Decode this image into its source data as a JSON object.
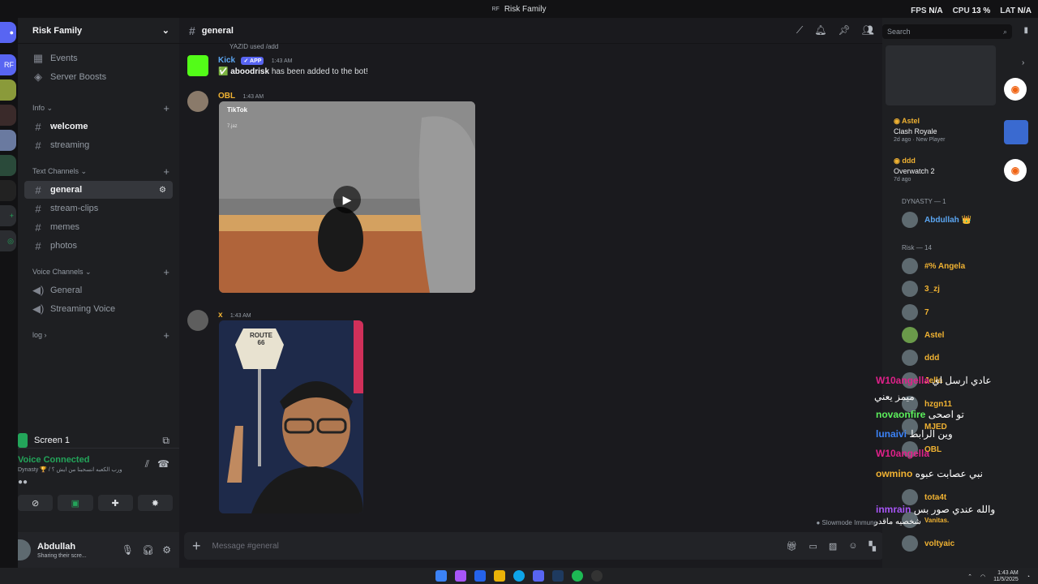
{
  "window": {
    "title": "Risk Family",
    "title_icon": "RF"
  },
  "hud": {
    "fps_label": "FPS",
    "fps_value": "N/A",
    "cpu_label": "CPU",
    "cpu_value": "13 %",
    "lat_label": "LAT",
    "lat_value": "N/A"
  },
  "server": {
    "name": "Risk Family",
    "rail_badge": "RF",
    "top_items": [
      {
        "label": "Events",
        "icon": "calendar-icon"
      },
      {
        "label": "Server Boosts",
        "icon": "boost-icon"
      }
    ],
    "categories": {
      "info": "Info",
      "text": "Text Channels",
      "voice": "Voice Channels",
      "log": "log"
    },
    "info_channels": [
      "welcome",
      "streaming"
    ],
    "text_channels": [
      "general",
      "stream-clips",
      "memes",
      "photos"
    ],
    "voice_channels": [
      "General",
      "Streaming Voice"
    ]
  },
  "screen_share": {
    "label": "Screen 1"
  },
  "voice_status": {
    "title": "Voice Connected",
    "subtitle": "Dynasty 🏆 / ورب الكعبه انسحبنا من ايش ؟"
  },
  "user": {
    "name": "Abdullah",
    "status": "Sharing their scre..."
  },
  "chat": {
    "channel": "general",
    "reply_preview": "YAZID used /add",
    "messages": [
      {
        "author": "Kick",
        "badge": "APP",
        "time": "1:43 AM",
        "mention": "aboodrisk",
        "text": "has been added to the bot!"
      },
      {
        "author": "OBL",
        "time": "1:43 AM",
        "video_brand": "TikTok",
        "video_handle": "7.jaz"
      },
      {
        "author": "x",
        "time": "1:43 AM",
        "sign_text": "ROUTE 66"
      }
    ],
    "composer_placeholder": "Message #general",
    "slowmode": "Slowmode Immune"
  },
  "members_panel": {
    "search_placeholder": "Search",
    "activities": [
      {
        "name": "Astel",
        "game": "Clash Royale",
        "meta": "2d ago",
        "meta2": "New Player"
      },
      {
        "name": "ddd",
        "game": "Overwatch 2",
        "meta": "7d ago"
      }
    ],
    "groups": [
      {
        "label": "DYNASTY — 1"
      },
      {
        "label": "Risk — 14"
      }
    ],
    "members": [
      {
        "name": "Abdullah 👑",
        "color": "#5ba6f2"
      },
      {
        "name": "#% Angela",
        "color": "#f0b232"
      },
      {
        "name": "3_zj",
        "color": "#f0b232"
      },
      {
        "name": "7",
        "color": "#f0b232"
      },
      {
        "name": "Astel",
        "color": "#f0b232"
      },
      {
        "name": "ddd",
        "color": "#f0b232"
      },
      {
        "name": "Jella",
        "color": "#f0b232"
      },
      {
        "name": "hzgn11",
        "color": "#f0b232"
      },
      {
        "name": "MJED",
        "color": "#f0b232"
      },
      {
        "name": "OBL",
        "color": "#f0b232"
      },
      {
        "name": "tota4t",
        "color": "#f0b232"
      },
      {
        "name": "Vanitas.",
        "color": "#f0b232"
      },
      {
        "name": "voltyaic",
        "color": "#f0b232"
      }
    ]
  },
  "overlay_chat": [
    {
      "user": "W10angella",
      "text": "عادي ارسل اي",
      "color": "#e0218a"
    },
    {
      "user": "",
      "text": "ميمز يعني",
      "color": "#ffffff"
    },
    {
      "user": "novaonfire",
      "text": "تو اصحى",
      "color": "#5cf05c"
    },
    {
      "user": "lunaivi",
      "text": "وين الرابط",
      "color": "#3b82f6"
    },
    {
      "user": "W10angella",
      "text": "",
      "color": "#e0218a"
    },
    {
      "user": "owmino",
      "text": "نبي عصابت عبوه",
      "color": "#f0b232"
    },
    {
      "user": "inmrain",
      "text": "والله عندي صور بس",
      "color": "#a855f7"
    },
    {
      "user": "",
      "text": "شخصيه ماقدر",
      "color": "#ffffff"
    }
  ],
  "taskbar": {
    "time": "1:43 AM",
    "date": "11/5/2025"
  }
}
